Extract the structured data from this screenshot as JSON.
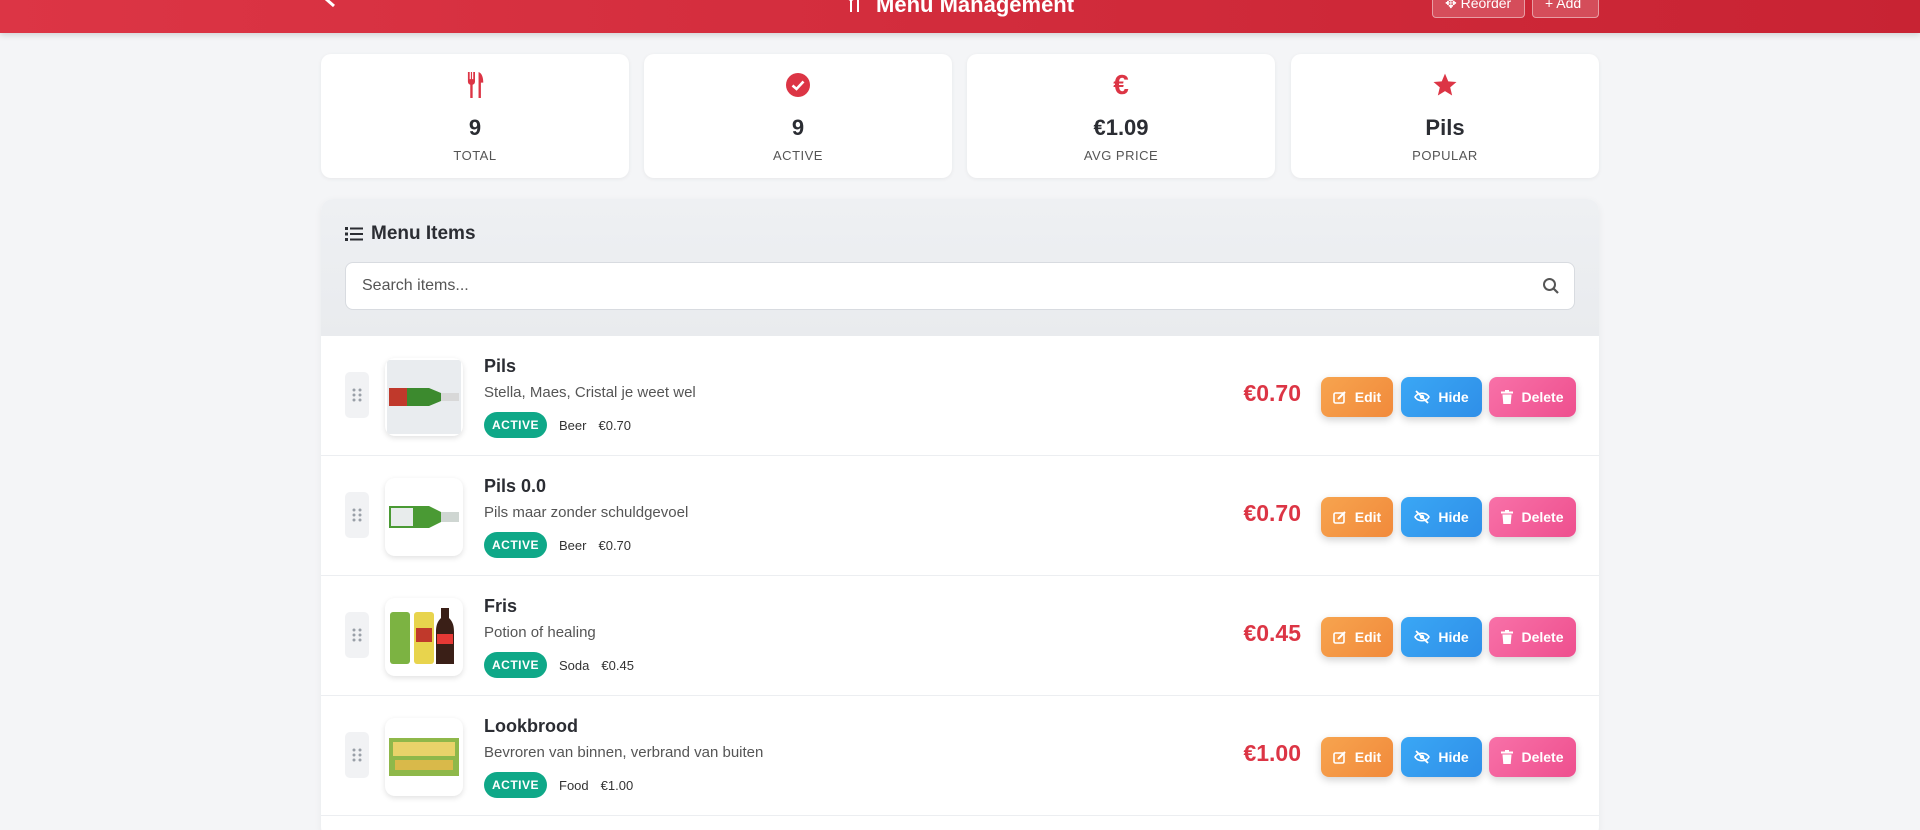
{
  "header": {
    "title": "Menu Management",
    "reorder_label": "Reorder",
    "add_label": "+ Add"
  },
  "stats": [
    {
      "value": "9",
      "label": "TOTAL",
      "icon": "utensils-icon"
    },
    {
      "value": "9",
      "label": "ACTIVE",
      "icon": "check-circle-icon"
    },
    {
      "value": "€1.09",
      "label": "AVG PRICE",
      "icon": "euro-icon"
    },
    {
      "value": "Pils",
      "label": "POPULAR",
      "icon": "star-icon"
    }
  ],
  "panel": {
    "title": "Menu Items",
    "search_placeholder": "Search items..."
  },
  "items": [
    {
      "name": "Pils",
      "description": "Stella, Maes, Cristal je weet wel",
      "status": "ACTIVE",
      "category": "Beer",
      "small_price": "€0.70",
      "price": "€0.70"
    },
    {
      "name": "Pils 0.0",
      "description": "Pils maar zonder schuldgevoel",
      "status": "ACTIVE",
      "category": "Beer",
      "small_price": "€0.70",
      "price": "€0.70"
    },
    {
      "name": "Fris",
      "description": "Potion of healing",
      "status": "ACTIVE",
      "category": "Soda",
      "small_price": "€0.45",
      "price": "€0.45"
    },
    {
      "name": "Lookbrood",
      "description": "Bevroren van binnen, verbrand van buiten",
      "status": "ACTIVE",
      "category": "Food",
      "small_price": "€1.00",
      "price": "€1.00"
    }
  ],
  "actions": {
    "edit_label": "Edit",
    "hide_label": "Hide",
    "delete_label": "Delete"
  },
  "colors": {
    "brand": "#dc3545",
    "active_badge": "#0fa888",
    "edit": "#f18a3b",
    "hide": "#2f8fe8",
    "delete": "#ee4f8e"
  }
}
